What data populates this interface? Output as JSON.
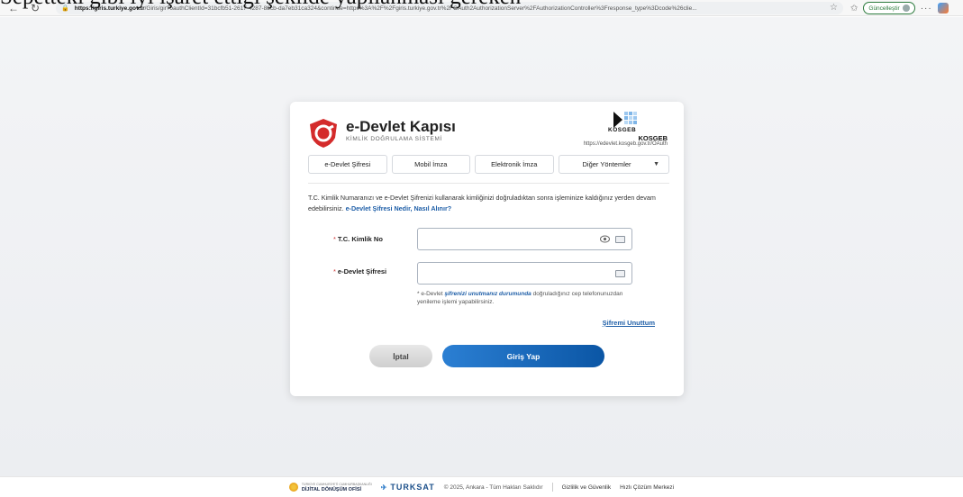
{
  "overlay_title": "Sepetteki gibi iyi işaret ettiği şekilde yapılanması gereken",
  "browser": {
    "url_host": "https://giris.turkiye.gov.tr",
    "url_path": "/Giris/gir?oauthClientId=31bcfb51-2617-4287-8bcb-da7eb31ca324&continue=https%3A%2F%2Fgiris.turkiye.gov.tr%2FOAuth2AuthorizationServer%2FAuthorizationController%3Fresponse_type%3Dcode%26clie...",
    "update_label": "Güncelleştir",
    "back_icon": "arrow-left-icon",
    "refresh_icon": "refresh-icon"
  },
  "card": {
    "brand_title": "e-Devlet Kapısı",
    "brand_subtitle": "KİMLİK DOĞRULAMA SİSTEMİ",
    "partner_name_small": "KOSGEB",
    "partner_name": "KOSGEB",
    "partner_url": "https://edevlet.kosgeb.gov.tr/OAuth",
    "tabs": [
      {
        "label": "e-Devlet Şifresi"
      },
      {
        "label": "Mobil İmza"
      },
      {
        "label": "Elektronik İmza"
      },
      {
        "label": "Diğer Yöntemler"
      }
    ],
    "intro_text": "T.C. Kimlik Numaranızı ve e-Devlet Şifrenizi kullanarak kimliğinizi doğruladıktan sonra işleminize kaldığınız yerden devam edebilirsiniz.",
    "intro_link": "e-Devlet Şifresi Nedir, Nasıl Alınır?",
    "tc_label": "T.C. Kimlik No",
    "tc_value": "",
    "password_label": "e-Devlet Şifresi",
    "password_value": "",
    "required_marker": "*",
    "hint_prefix": "* e-Devlet",
    "hint_link": "şifrenizi unutmanız durumunda",
    "hint_suffix": "doğruladığınız cep telefonunuzdan yenileme işlemi yapabilirsiniz.",
    "forgot_label": "Şifremi Unuttum",
    "cancel_label": "İptal",
    "login_label": "Giriş Yap"
  },
  "footer": {
    "ddo_top": "TÜRKİYE CUMHURİYETİ CUMHURBAŞKANLIĞI",
    "ddo_bottom": "DİJİTAL DÖNÜŞÜM OFİSİ",
    "turksat": "TURKSAT",
    "copyright": "© 2025, Ankara - Tüm Hakları Saklıdır",
    "privacy": "Gizlilik ve Güvenlik",
    "help": "Hızlı Çözüm Merkezi"
  },
  "colors": {
    "accent": "#1f5fa8",
    "brand_red": "#d42b2b",
    "login_button": "#0b56a5"
  }
}
